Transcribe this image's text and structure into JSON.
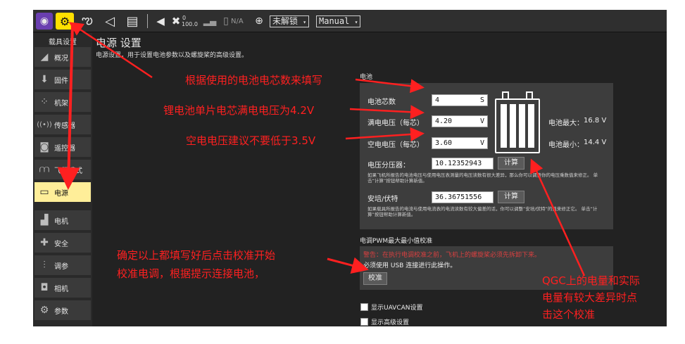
{
  "toolbar": {
    "satellite_count": "0",
    "hdop": "100.0",
    "battery_na": "N/A",
    "arm_status": "未解锁",
    "flight_mode": "Manual",
    "icons": [
      "qgc-logo-icon",
      "gears-icon",
      "plan-waypoint-icon",
      "fly-paperplane-icon",
      "analyze-icon",
      "megaphone-icon",
      "gps-satellite-icon",
      "rc-signal-icon",
      "battery-icon",
      "gimbal-target-icon"
    ]
  },
  "sidebar": {
    "header": "载具设置",
    "items": [
      {
        "label": "概况",
        "icon": "plane-icon"
      },
      {
        "label": "固件",
        "icon": "firmware-icon"
      },
      {
        "label": "机架",
        "icon": "airframe-icon"
      },
      {
        "label": "传感器",
        "icon": "sensors-icon"
      },
      {
        "label": "遥控器",
        "icon": "radio-icon"
      },
      {
        "label": "飞行模式",
        "icon": "flight-modes-icon"
      },
      {
        "label": "电源",
        "icon": "power-icon",
        "active": true
      },
      {
        "label": "电机",
        "icon": "motors-icon"
      },
      {
        "label": "安全",
        "icon": "safety-icon"
      },
      {
        "label": "调参",
        "icon": "tuning-icon"
      },
      {
        "label": "相机",
        "icon": "camera-icon"
      },
      {
        "label": "参数",
        "icon": "parameters-icon"
      }
    ]
  },
  "page": {
    "title": "电源 设置",
    "description": "电源设置，用于设置电池参数以及螺旋桨的高级设置。"
  },
  "battery": {
    "section_title": "电池",
    "cells_label": "电池芯数",
    "cells_value": "4",
    "cells_unit": "S",
    "full_label": "满电电压（每芯）",
    "full_value": "4.20",
    "full_unit": "V",
    "empty_label": "空电电压（每芯）",
    "empty_value": "3.60",
    "empty_unit": "V",
    "max_label": "电池最大：",
    "max_value": "16.8 V",
    "min_label": "电池最小：",
    "min_value": "14.4 V",
    "divider_label": "电压分压器：",
    "divider_value": "10.12352943",
    "calc_label": "计算",
    "divider_note": "如果飞机所报告的电池电压与使用电压表测量的电压读数有很大差异，那么你可以调整你的电压乘数值来修正。 单击“计算”按钮帮助计算新值。",
    "amps_label": "安培/伏特",
    "amps_value": "36.36751556",
    "calc2_label": "计算",
    "amps_note": "如果载具所报告的电流与使用电流表的电流读数有较大偏差的话，你可以调整“安培/伏特”的值来修正它。 单击“计算”按钮帮助计算新值。"
  },
  "esc": {
    "section_title": "电调PWM最大最小值校准",
    "warning": "警告：在执行电调校准之前，飞机上的螺旋桨必须先拆卸下来。",
    "usb_note": "必须使用 USB 连接进行此操作。",
    "calibrate_label": "校准"
  },
  "options": {
    "uavcan_label": "显示UAVCAN设置",
    "advanced_label": "显示高级设置"
  },
  "annotations": {
    "a1": "根据使用的电池电芯数来填写",
    "a2": "锂电池单片电芯满电电压为4.2V",
    "a3": "空电电压建议不要低于3.5V",
    "a4_line1": "确定以上都填写好后点击校准开始",
    "a4_line2": "校准电调，根据提示连接电池，",
    "a5_line1": "QGC上的电量和实际",
    "a5_line2": "电量有较大差异时点",
    "a5_line3": "击这个校准"
  },
  "colors": {
    "annotation": "#ff2020",
    "active_item": "#ffee99",
    "toolbar_highlight": "#ffe000",
    "warning": "#d94040"
  }
}
